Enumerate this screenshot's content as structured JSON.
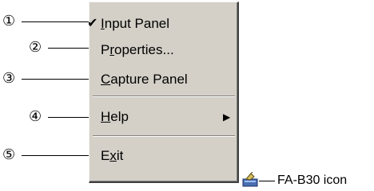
{
  "menu": {
    "items": [
      {
        "pre": "",
        "u": "I",
        "post": "nput Panel",
        "checked": true
      },
      {
        "pre": "P",
        "u": "r",
        "post": "operties..."
      },
      {
        "pre": "",
        "u": "C",
        "post": "apture Panel"
      },
      {
        "pre": "",
        "u": "H",
        "post": "elp",
        "submenu": true
      },
      {
        "pre": "E",
        "u": "x",
        "post": "it"
      }
    ]
  },
  "callouts": [
    "①",
    "②",
    "③",
    "④",
    "⑤"
  ],
  "icon_label": "FA-B30 icon",
  "icons": {
    "check": "checkmark-icon",
    "arrow": "submenu-arrow-icon",
    "tray": "fa-b30-tray-icon"
  }
}
